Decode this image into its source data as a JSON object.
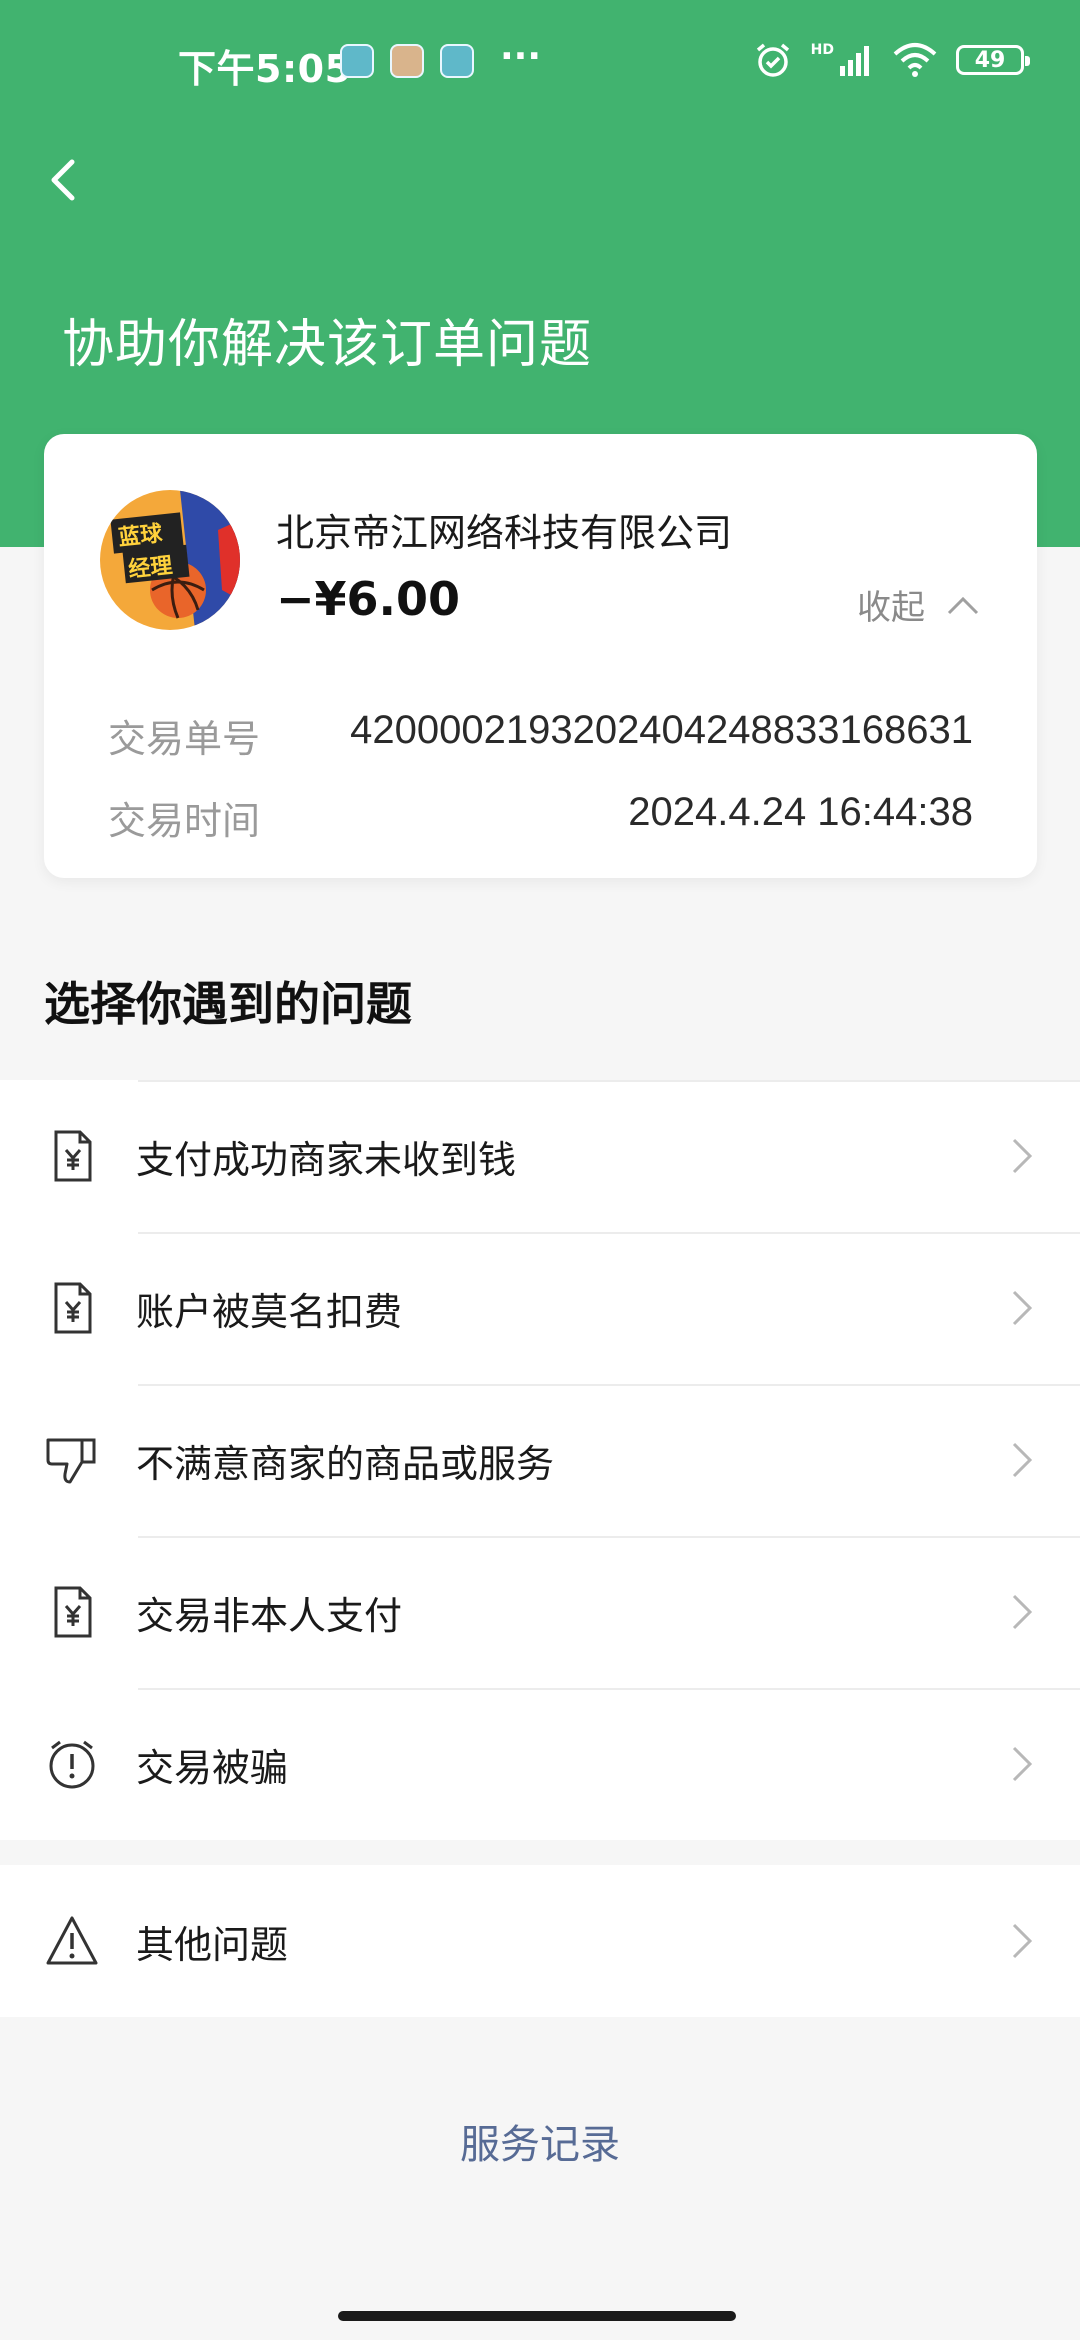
{
  "status_bar": {
    "time": "下午5:05",
    "dots": "···",
    "battery": "49",
    "hd": "HD"
  },
  "header": {
    "title": "协助你解决该订单问题"
  },
  "order": {
    "merchant_name": "北京帝江网络科技有限公司",
    "amount": "−¥6.00",
    "collapse_label": "收起",
    "logo_text": [
      "蓝球",
      "经理"
    ],
    "details": [
      {
        "label": "交易单号",
        "value": "4200002193202404248833168631"
      },
      {
        "label": "交易时间",
        "value": "2024.4.24 16:44:38"
      }
    ]
  },
  "problems": {
    "title": "选择你遇到的问题",
    "items": [
      {
        "label": "支付成功商家未收到钱",
        "icon": "receipt-icon"
      },
      {
        "label": "账户被莫名扣费",
        "icon": "receipt-icon"
      },
      {
        "label": "不满意商家的商品或服务",
        "icon": "thumbs-down-icon"
      },
      {
        "label": "交易非本人支付",
        "icon": "receipt-icon"
      },
      {
        "label": "交易被骗",
        "icon": "alarm-alert-icon"
      }
    ],
    "other": {
      "label": "其他问题",
      "icon": "warning-triangle-icon"
    }
  },
  "footer": {
    "service_record": "服务记录"
  },
  "colors": {
    "header_green": "#41b36f",
    "link_blue": "#576b95"
  }
}
